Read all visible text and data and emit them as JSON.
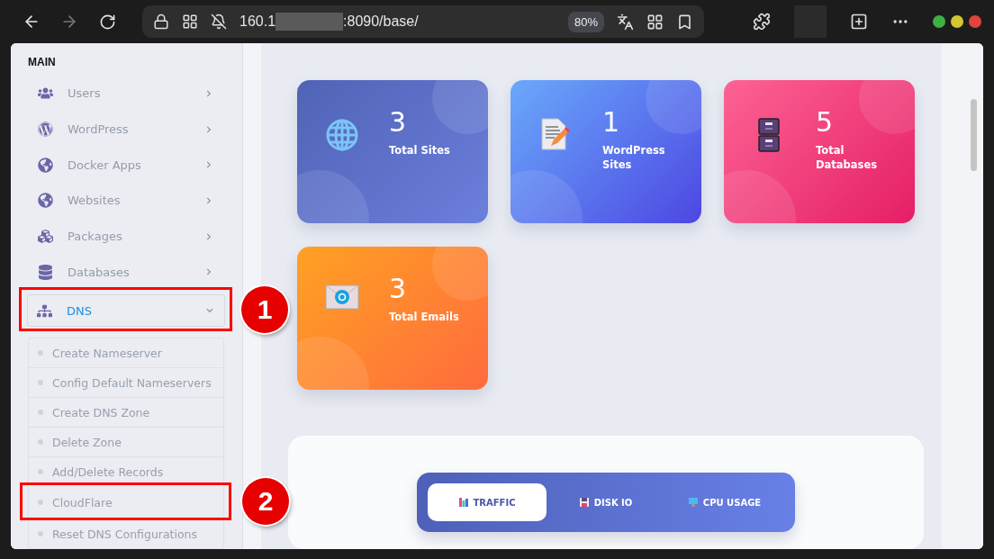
{
  "browser": {
    "url_start": "160.1",
    "url_end": ":8090/base/",
    "zoom": "80%"
  },
  "sidebar": {
    "heading": "MAIN",
    "items": [
      {
        "label": "Users",
        "expanded": false
      },
      {
        "label": "WordPress",
        "expanded": false
      },
      {
        "label": "Docker Apps",
        "expanded": false
      },
      {
        "label": "Websites",
        "expanded": false
      },
      {
        "label": "Packages",
        "expanded": false
      },
      {
        "label": "Databases",
        "expanded": false
      },
      {
        "label": "DNS",
        "expanded": true,
        "callout": "1",
        "children": [
          {
            "label": "Create Nameserver"
          },
          {
            "label": "Config Default Nameservers"
          },
          {
            "label": "Create DNS Zone"
          },
          {
            "label": "Delete Zone"
          },
          {
            "label": "Add/Delete Records"
          },
          {
            "label": "CloudFlare",
            "callout": "2"
          },
          {
            "label": "Reset DNS Configurations"
          }
        ]
      }
    ]
  },
  "cards": [
    {
      "value": "3",
      "label": "Total Sites"
    },
    {
      "value": "1",
      "label": "WordPress Sites"
    },
    {
      "value": "5",
      "label": "Total Databases"
    },
    {
      "value": "3",
      "label": "Total Emails"
    }
  ],
  "chart_tabs": [
    {
      "label": "TRAFFIC",
      "selected": true
    },
    {
      "label": "DISK IO",
      "selected": false
    },
    {
      "label": "CPU USAGE",
      "selected": false
    }
  ]
}
